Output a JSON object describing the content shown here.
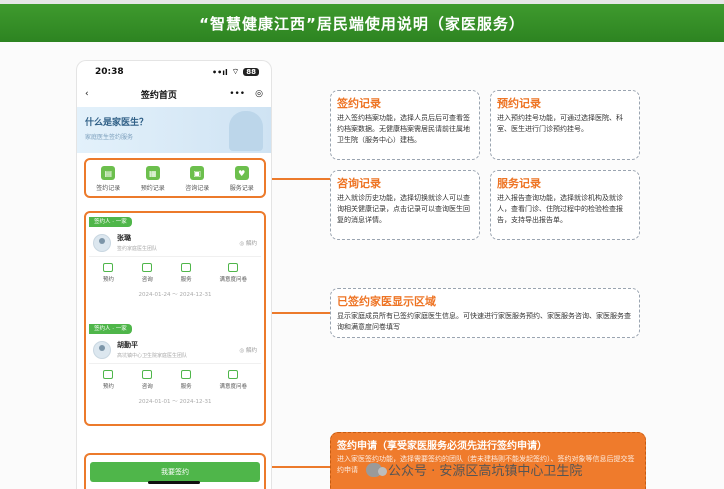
{
  "banner": {
    "title": "“智慧健康江西”居民端使用说明（家医服务）"
  },
  "phone": {
    "status": {
      "time": "20:38",
      "signal": "••ıl",
      "wifi": "⌔",
      "battery": "88"
    },
    "nav": {
      "back": "‹",
      "title": "签约首页",
      "more": "•••",
      "target": "◎"
    },
    "hero": {
      "title": "什么是家医生？",
      "subtitle": "家庭医生签约服务"
    },
    "quick": [
      {
        "label": "签约记录",
        "icon": "record-icon"
      },
      {
        "label": "预约记录",
        "icon": "calendar-icon"
      },
      {
        "label": "咨询记录",
        "icon": "chat-icon"
      },
      {
        "label": "服务记录",
        "icon": "heart-icon"
      }
    ],
    "cards": [
      {
        "tag": "签约人 · 一家",
        "name": "张璐",
        "sub": "签约家庭医生团队",
        "button": "◎ 解约",
        "actions": [
          "预约",
          "咨询",
          "服务",
          "满意度问卷"
        ],
        "dates": "2024-01-24 ～ 2024-12-31"
      },
      {
        "tag": "签约人 · 一家",
        "name": "胡勤平",
        "sub": "高坑镇中心卫生院家庭医生团队",
        "button": "◎ 解约",
        "actions": [
          "预约",
          "咨询",
          "服务",
          "满意度问卷"
        ],
        "dates": "2024-01-01 ～ 2024-12-31"
      }
    ],
    "apply_button": "我要签约"
  },
  "callouts": {
    "sign_record": {
      "title": "签约记录",
      "text": "进入签约档案功能，选择人员后后可查看签约档案数据。无健康档案需居民请前往属地卫生院（服务中心）建档。"
    },
    "appointment": {
      "title": "预约记录",
      "text": "进入预约挂号功能，可通过选择医院、科室、医生进行门诊预约挂号。"
    },
    "consult": {
      "title": "咨询记录",
      "text": "进入就诊历史功能，选择切换就诊人可以查询相关健康记录，点击记录可以查询医生回复的消息详情。"
    },
    "service": {
      "title": "服务记录",
      "text": "进入报告查询功能，选择就诊机构及就诊人，查看门诊、住院过程中的检验检查报告，支持导出报告单。"
    },
    "signed_area": {
      "title": "已签约家医显示区域",
      "text": "显示家庭成员所有已签约家庭医生信息。可快速进行家医服务预约、家医服务咨询、家医服务查询和满意度问卷填写"
    },
    "apply": {
      "title": "签约申请（享受家医服务必须先进行签约申请）",
      "text": "进入家医签约功能，选择需要签约的团队（若未建档则不能发起签约）、签约对象等信息后提交签约申请"
    }
  },
  "watermark": {
    "text": "公众号 · 安源区高坑镇中心卫生院"
  },
  "colors": {
    "accent": "#ec7a2b",
    "brand_green": "#3f9a2e"
  }
}
